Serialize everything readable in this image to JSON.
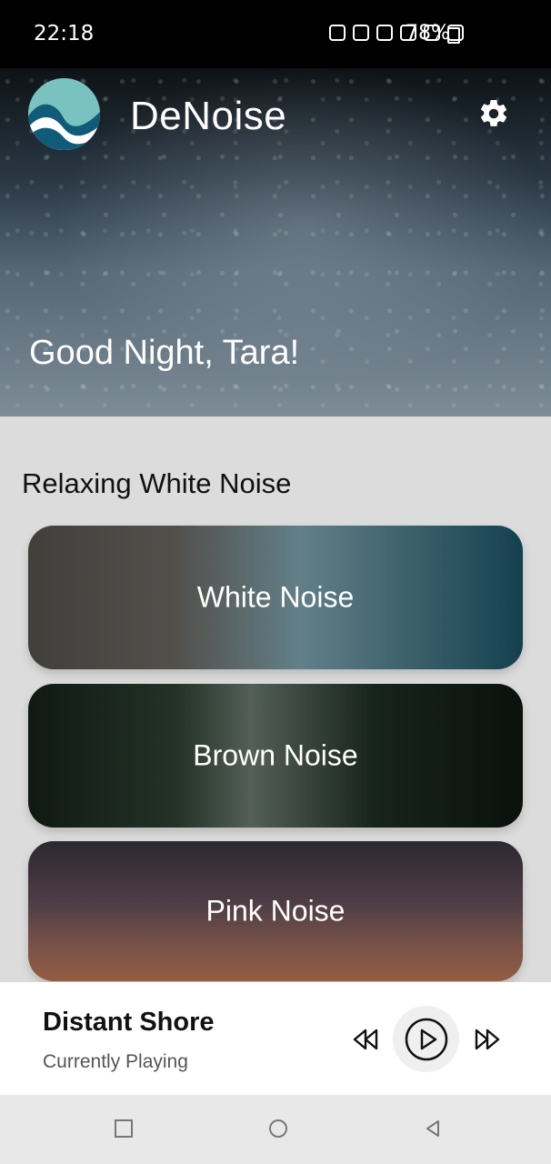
{
  "status_bar": {
    "time": "22:18",
    "battery": "78%",
    "icons": [
      "camera-icon",
      "alarm-icon",
      "mute-icon",
      "wifi-icon",
      "volte-icon",
      "signal-icon"
    ]
  },
  "header": {
    "app_name": "DeNoise",
    "greeting": "Good Night, Tara!"
  },
  "section": {
    "title": "Relaxing White Noise",
    "cards": [
      {
        "label": "White Noise"
      },
      {
        "label": "Brown Noise"
      },
      {
        "label": "Pink Noise"
      }
    ]
  },
  "player": {
    "track_name": "Distant Shore",
    "status": "Currently Playing"
  }
}
